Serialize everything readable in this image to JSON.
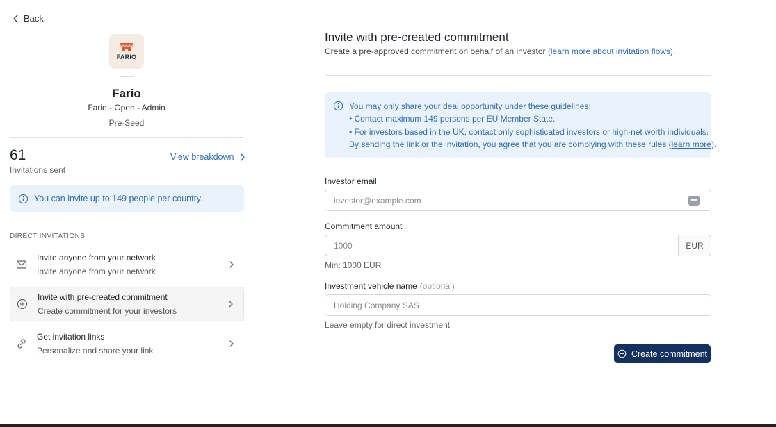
{
  "sidebar": {
    "back_label": "Back",
    "logo_text": "FARIO",
    "company_name": "Fario",
    "company_meta": "Fario - Open - Admin",
    "company_stage": "Pre-Seed",
    "stats": {
      "value": "61",
      "label": "Invitations sent",
      "breakdown_link": "View breakdown"
    },
    "info_text": "You can invite up to 149 people per country.",
    "section_title": "DIRECT INVITATIONS",
    "items": [
      {
        "title": "Invite anyone from your network",
        "subtitle": "Invite anyone from your network",
        "icon": "mail-icon"
      },
      {
        "title": "Invite with pre-created commitment",
        "subtitle": "Create commitment for your investors",
        "icon": "plus-circle-icon",
        "active": true
      },
      {
        "title": "Get invitation links",
        "subtitle": "Personalize and share your link",
        "icon": "link-icon"
      }
    ]
  },
  "main": {
    "title": "Invite with pre-created commitment",
    "subtitle_prefix": "Create a pre-approved commitment on behalf of an investor ",
    "subtitle_link": "(learn more about invitation flows)",
    "subtitle_suffix": ".",
    "guidelines": {
      "line1": "You may only share your deal opportunity under these guidelines:",
      "line2": "• Contact maximum 149 persons per EU Member State.",
      "line3": "• For investors based in the UK, contact only sophisticated investors or high-net worth individuals.",
      "line4_prefix": "By sending the link or the invitation, you agree that you are complying with these rules (",
      "line4_link": "learn more",
      "line4_suffix": ")."
    },
    "form": {
      "email_label": "Investor email",
      "email_placeholder": "investor@example.com",
      "amount_label": "Commitment amount",
      "amount_placeholder": "1000",
      "amount_currency": "EUR",
      "amount_help": "Min: 1000 EUR",
      "vehicle_label": "Investment vehicle name",
      "vehicle_optional": "(optional)",
      "vehicle_placeholder": "Holding Company SAS",
      "vehicle_help": "Leave empty for direct investment",
      "submit_label": "Create commitment"
    }
  },
  "colors": {
    "accent": "#2f6fb5",
    "info_bg": "#eaf3fb",
    "primary_button": "#14305e"
  }
}
